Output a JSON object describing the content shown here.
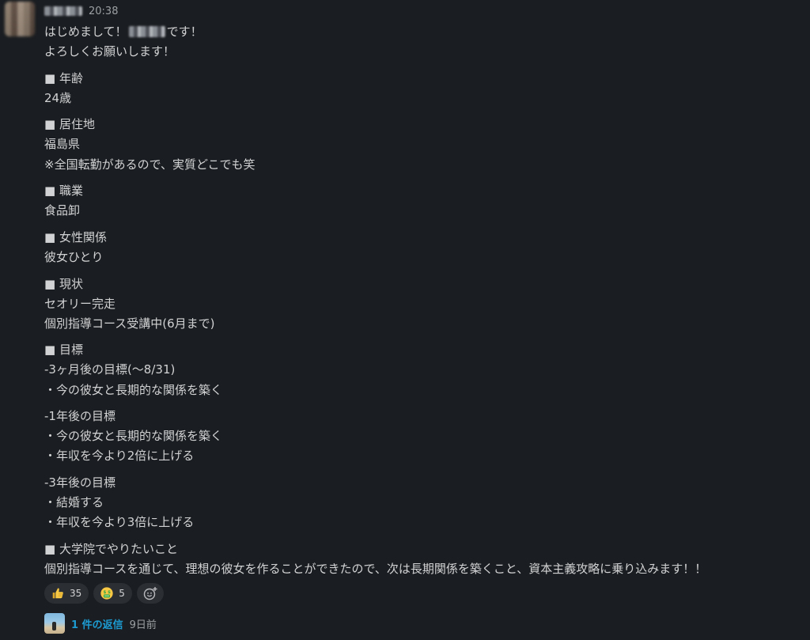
{
  "message": {
    "sender": "",
    "timestamp": "20:38",
    "greeting_before": "はじめまして！",
    "greeting_after": "です！",
    "lines": [
      "よろしくお願いします！",
      "",
      "■ 年齢",
      "24歳",
      "",
      "■ 居住地",
      "福島県",
      "※全国転勤があるので、実質どこでも笑",
      "",
      "■ 職業",
      "食品卸",
      "",
      "■ 女性関係",
      "彼女ひとり",
      "",
      "■ 現状",
      "セオリー完走",
      "個別指導コース受講中(6月まで)",
      "",
      "■ 目標",
      "-3ヶ月後の目標(〜8/31)",
      "・今の彼女と長期的な関係を築く",
      "",
      "-1年後の目標",
      "・今の彼女と長期的な関係を築く",
      "・年収を今より2倍に上げる",
      "",
      "-3年後の目標",
      "・結婚する",
      "・年収を今より3倍に上げる",
      "",
      "■ 大学院でやりたいこと",
      "個別指導コースを通じて、理想の彼女を作ることができたので、次は長期関係を築くこと、資本主義攻略に乗り込みます！！"
    ]
  },
  "reactions": [
    {
      "icon": "thumbs-up-icon",
      "count": "35"
    },
    {
      "icon": "money-mouth-face-icon",
      "count": "5"
    }
  ],
  "add_reaction_icon": "add-reaction-icon",
  "thread": {
    "replies_label": "1 件の返信",
    "time": "9日前"
  },
  "colors": {
    "background": "#1a1d21",
    "text": "#d1d2d3",
    "muted": "#9da0a3",
    "link": "#1d9bd1",
    "pill": "#2b2e33"
  }
}
